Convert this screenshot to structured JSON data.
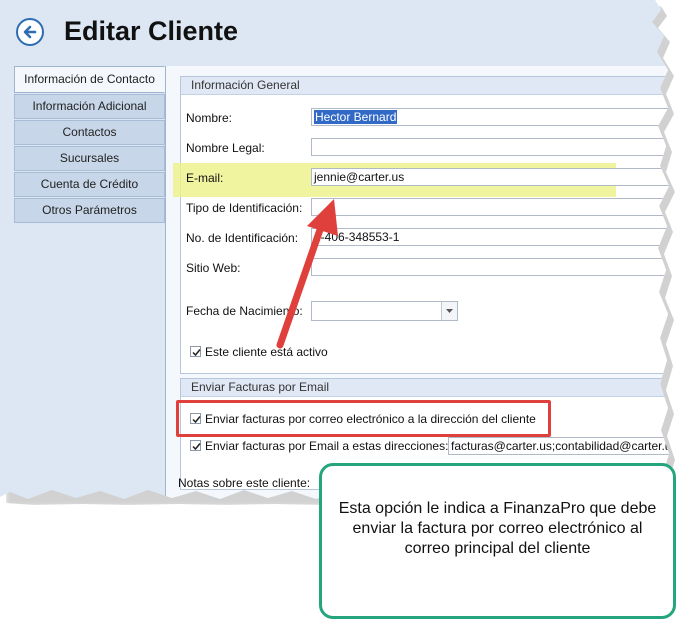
{
  "window": {
    "title": "Editar Cliente"
  },
  "nav": {
    "items": [
      {
        "label": "Información de Contacto",
        "active": true
      },
      {
        "label": "Información Adicional"
      },
      {
        "label": "Contactos"
      },
      {
        "label": "Sucursales"
      },
      {
        "label": "Cuenta de Crédito"
      },
      {
        "label": "Otros Parámetros"
      }
    ]
  },
  "general": {
    "title": "Información General",
    "nombre_label": "Nombre:",
    "nombre_value": "Hector Bernard",
    "nombre_legal_label": "Nombre Legal:",
    "nombre_legal_value": "",
    "email_label": "E-mail:",
    "email_value": "jennie@carter.us",
    "tipo_id_label": "Tipo de Identificación:",
    "tipo_id_value": "",
    "no_id_label": "No. de Identificación:",
    "no_id_value": "1-406-348553-1",
    "sitio_web_label": "Sitio Web:",
    "sitio_web_value": "",
    "fecha_label": "Fecha de Nacimiento:",
    "fecha_value": "",
    "activo_label": "Este cliente está activo",
    "activo_checked": true
  },
  "facturas": {
    "title": "Enviar Facturas por Email",
    "opt1_label": "Enviar facturas por correo electrónico a la dirección del cliente",
    "opt1_checked": true,
    "opt2_label": "Enviar facturas por Email a estas direcciones:",
    "opt2_checked": true,
    "opt2_value": "facturas@carter.us;contabilidad@carter.us"
  },
  "notas_label": "Notas sobre este cliente:",
  "callout": {
    "text": "Esta opción le indica a FinanzaPro que debe enviar la factura por correo electrónico al correo principal del cliente"
  },
  "colors": {
    "highlight": "#eef28a",
    "annotation_red": "#e0403c",
    "callout_border": "#25a57d",
    "accent_blue": "#2d6db3"
  }
}
